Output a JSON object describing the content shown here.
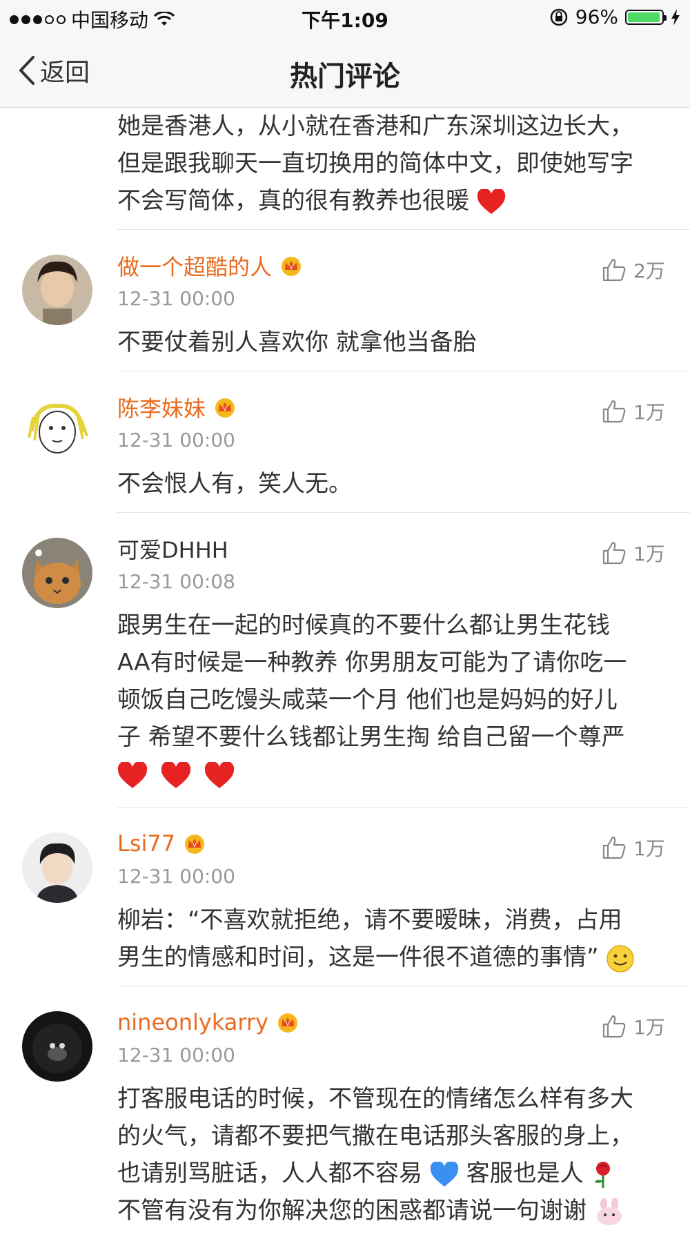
{
  "status_bar": {
    "carrier": "中国移动",
    "time": "下午1:09",
    "battery": "96%",
    "battery_level": 0.96
  },
  "nav": {
    "back_label": "返回",
    "title": "热门评论"
  },
  "partial_comment": {
    "lines": [
      "她是香港人，从小就在香港和广东深圳这边长大，",
      "但是跟我聊天一直切换用的简体中文，即使她写字",
      "不会写简体，真的很有教养也很暖"
    ]
  },
  "comments": [
    {
      "name": "做一个超酷的人",
      "vip": true,
      "time": "12-31 00:00",
      "likes": "2万",
      "lines": [
        "不要仗着别人喜欢你 就拿他当备胎"
      ]
    },
    {
      "name": "陈李妹妹",
      "vip": true,
      "time": "12-31 00:00",
      "likes": "1万",
      "lines": [
        "不会恨人有，笑人无。"
      ]
    },
    {
      "name": "可爱DHHH",
      "vip": false,
      "time": "12-31 00:08",
      "likes": "1万",
      "lines": [
        "跟男生在一起的时候真的不要什么都让男生花钱",
        "AA有时候是一种教养 你男朋友可能为了请你吃一",
        "顿饭自己吃馒头咸菜一个月 他们也是妈妈的好儿",
        "子 希望不要什么钱都让男生掏 给自己留一个尊严"
      ]
    },
    {
      "name": "Lsi77",
      "vip": true,
      "time": "12-31 00:00",
      "likes": "1万",
      "lines": [
        "柳岩：“不喜欢就拒绝，请不要暧昧，消费，占用",
        "男生的情感和时间，这是一件很不道德的事情”"
      ]
    },
    {
      "name": "nineonlykarry",
      "vip": true,
      "time": "12-31 00:00",
      "likes": "1万",
      "lines": [
        "打客服电话的时候，不管现在的情绪怎么样有多大",
        "的火气，请都不要把气撒在电话那头客服的身上，",
        "也请别骂脏话，人人都不容易",
        "不管有没有为你解决您的困惑都请说一句谢谢"
      ],
      "line3_suffix": "客服也是人"
    }
  ]
}
